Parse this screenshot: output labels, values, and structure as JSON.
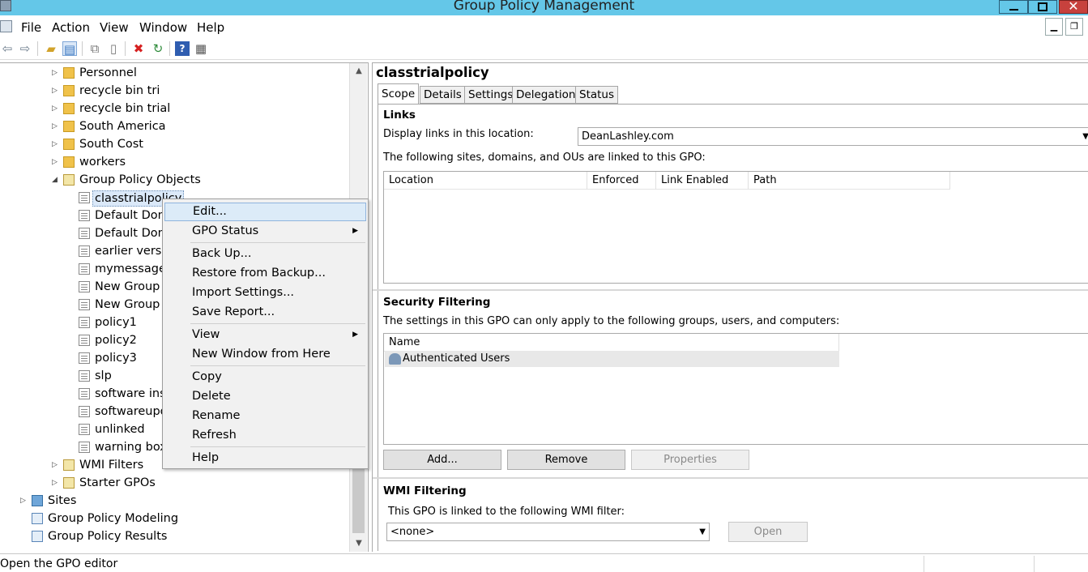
{
  "window": {
    "title": "Group Policy Management",
    "close_glyph": "✕"
  },
  "menubar": {
    "items": [
      "File",
      "Action",
      "View",
      "Window",
      "Help"
    ]
  },
  "toolbar": {
    "icons": [
      "back-icon",
      "forward-icon",
      "up-folder-icon",
      "show-hide-tree-icon",
      "copy-icon",
      "paste-icon",
      "delete-icon",
      "refresh-icon",
      "help-icon",
      "properties-icon"
    ]
  },
  "tree": {
    "items": [
      {
        "label": "Personnel",
        "type": "folder"
      },
      {
        "label": "recycle bin tri",
        "type": "folder"
      },
      {
        "label": "recycle bin trial",
        "type": "folder"
      },
      {
        "label": "South America",
        "type": "folder"
      },
      {
        "label": "South Cost",
        "type": "folder"
      },
      {
        "label": "workers",
        "type": "folder"
      },
      {
        "label": "Group Policy Objects",
        "type": "gpo-container",
        "expanded": true
      },
      {
        "label": "classtrialpolicy",
        "type": "gpo",
        "selected": true
      },
      {
        "label": "Default Dom",
        "type": "gpo"
      },
      {
        "label": "Default Dom",
        "type": "gpo"
      },
      {
        "label": "earlier versic",
        "type": "gpo"
      },
      {
        "label": "mymessage",
        "type": "gpo"
      },
      {
        "label": "New Group P",
        "type": "gpo"
      },
      {
        "label": "New Group P",
        "type": "gpo"
      },
      {
        "label": "policy1",
        "type": "gpo"
      },
      {
        "label": "policy2",
        "type": "gpo"
      },
      {
        "label": "policy3",
        "type": "gpo"
      },
      {
        "label": "slp",
        "type": "gpo"
      },
      {
        "label": "software inst",
        "type": "gpo"
      },
      {
        "label": "softwareupd",
        "type": "gpo"
      },
      {
        "label": "unlinked",
        "type": "gpo"
      },
      {
        "label": "warning box",
        "type": "gpo"
      },
      {
        "label": "WMI Filters",
        "type": "gpo-container"
      },
      {
        "label": "Starter GPOs",
        "type": "gpo-container"
      },
      {
        "label": "Sites",
        "type": "site"
      },
      {
        "label": "Group Policy Modeling",
        "type": "model"
      },
      {
        "label": "Group Policy Results",
        "type": "model"
      }
    ]
  },
  "context_menu": {
    "items": [
      "Edit...",
      "GPO Status",
      "Back Up...",
      "Restore from Backup...",
      "Import Settings...",
      "Save Report...",
      "View",
      "New Window from Here",
      "Copy",
      "Delete",
      "Rename",
      "Refresh",
      "Help"
    ],
    "highlighted": "Edit..."
  },
  "details": {
    "title": "classtrialpolicy",
    "tabs": [
      "Scope",
      "Details",
      "Settings",
      "Delegation",
      "Status"
    ],
    "active_tab": "Scope",
    "links": {
      "heading": "Links",
      "display_label": "Display links in this location:",
      "location_value": "DeanLashley.com",
      "linked_text": "The following sites, domains, and OUs are linked to this GPO:",
      "columns": [
        "Location",
        "Enforced",
        "Link Enabled",
        "Path"
      ]
    },
    "security": {
      "heading": "Security Filtering",
      "text": "The settings in this GPO can only apply to the following groups, users, and computers:",
      "column": "Name",
      "rows": [
        "Authenticated Users"
      ],
      "buttons": {
        "add": "Add...",
        "remove": "Remove",
        "properties": "Properties"
      }
    },
    "wmi": {
      "heading": "WMI Filtering",
      "text": "This GPO is linked to the following WMI filter:",
      "filter_value": "<none>",
      "open_label": "Open"
    }
  },
  "statusbar": {
    "text": "Open the GPO editor"
  },
  "colors": {
    "titlebar": "#64c7e8",
    "selection": "#dcebf8",
    "close": "#c7413d"
  }
}
